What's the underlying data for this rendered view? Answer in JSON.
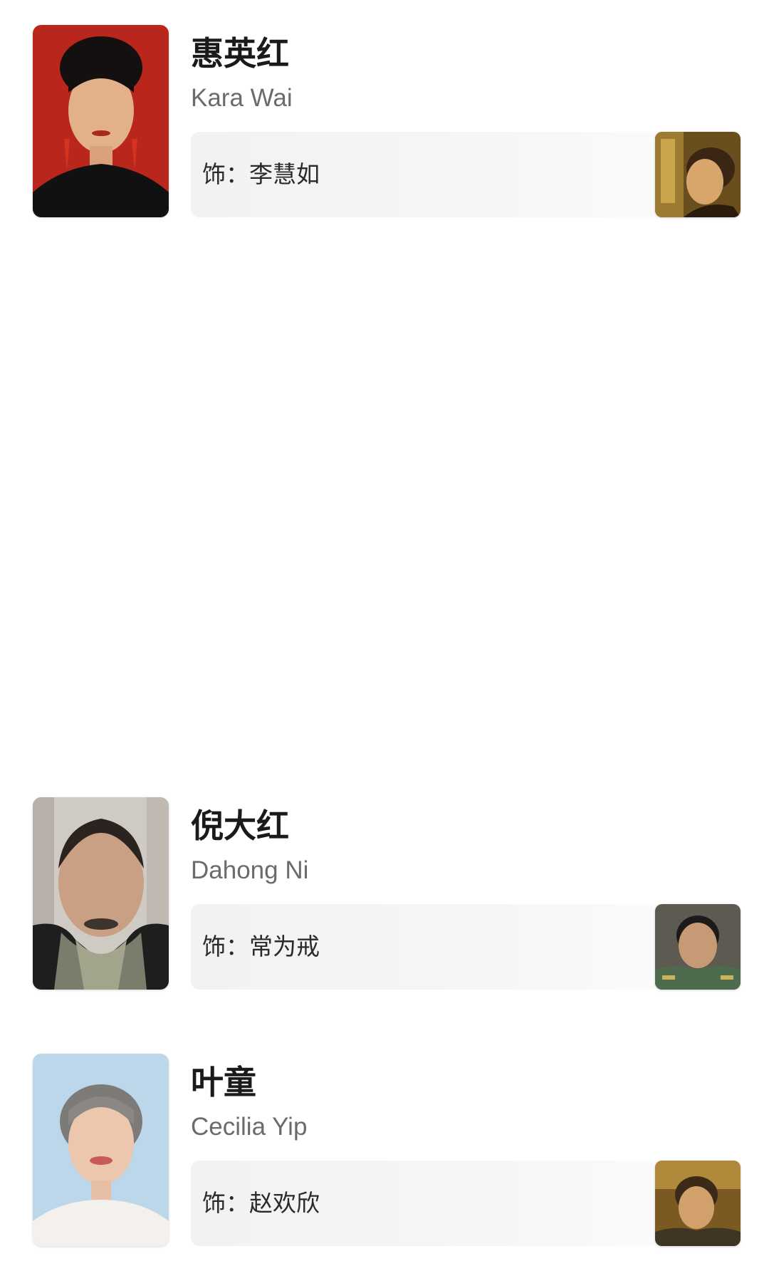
{
  "cast": [
    {
      "name_zh": "惠英红",
      "name_en": "Kara Wai",
      "role_prefix": "饰：",
      "role_name": "李慧如",
      "photo_icon": "actor-portrait-red-background",
      "still_icon": "character-still-sepia"
    },
    {
      "name_zh": "倪大红",
      "name_en": "Dahong Ni",
      "role_prefix": "饰：",
      "role_name": "常为戒",
      "photo_icon": "actor-portrait-grey-background",
      "still_icon": "character-still-uniform"
    },
    {
      "name_zh": "叶童",
      "name_en": "Cecilia Yip",
      "role_prefix": "饰：",
      "role_name": "赵欢欣",
      "photo_icon": "actor-portrait-blue-background",
      "still_icon": "character-still-sepia"
    }
  ],
  "colors": {
    "name_text": "#1a1a1a",
    "english_text": "#6b6b6b",
    "role_box_bg": "#f2f2f2",
    "page_bg": "#ffffff"
  }
}
